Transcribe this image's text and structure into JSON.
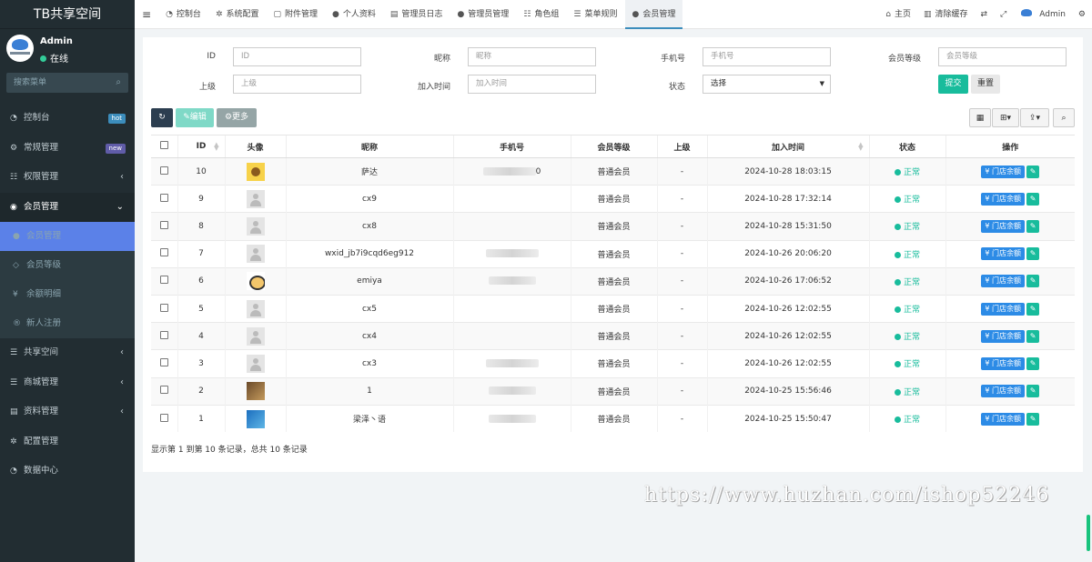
{
  "app": {
    "title": "TB共享空间"
  },
  "user": {
    "name": "Admin",
    "status": "在线"
  },
  "sidebar": {
    "search_placeholder": "搜索菜单",
    "items": [
      {
        "label": "控制台",
        "badge": "hot"
      },
      {
        "label": "常规管理",
        "badge": "new"
      },
      {
        "label": "权限管理",
        "arrow": "‹"
      },
      {
        "label": "会员管理",
        "arrow": "⌄"
      },
      {
        "label": "会员管理"
      },
      {
        "label": "会员等级"
      },
      {
        "label": "余额明细"
      },
      {
        "label": "新人注册"
      },
      {
        "label": "共享空间",
        "arrow": "‹"
      },
      {
        "label": "商城管理",
        "arrow": "‹"
      },
      {
        "label": "资料管理",
        "arrow": "‹"
      },
      {
        "label": "配置管理"
      },
      {
        "label": "数据中心"
      }
    ]
  },
  "topbar": {
    "tabs": [
      {
        "label": "控制台"
      },
      {
        "label": "系统配置"
      },
      {
        "label": "附件管理"
      },
      {
        "label": "个人资料"
      },
      {
        "label": "管理员日志"
      },
      {
        "label": "管理员管理"
      },
      {
        "label": "角色组"
      },
      {
        "label": "菜单规则"
      },
      {
        "label": "会员管理"
      }
    ],
    "right": {
      "home": "主页",
      "clear_cache": "清除缓存",
      "admin": "Admin"
    }
  },
  "filters": {
    "id": {
      "label": "ID",
      "placeholder": "ID"
    },
    "nickname": {
      "label": "昵称",
      "placeholder": "昵称"
    },
    "mobile": {
      "label": "手机号",
      "placeholder": "手机号"
    },
    "level": {
      "label": "会员等级",
      "placeholder": "会员等级"
    },
    "parent": {
      "label": "上级",
      "placeholder": "上级"
    },
    "jointime": {
      "label": "加入时间",
      "placeholder": "加入时间"
    },
    "status": {
      "label": "状态",
      "value": "选择"
    },
    "submit": "提交",
    "reset": "重置"
  },
  "toolbar": {
    "edit": "编辑",
    "more": "更多"
  },
  "table": {
    "headers": [
      "ID",
      "头像",
      "昵称",
      "手机号",
      "会员等级",
      "上级",
      "加入时间",
      "状态",
      "操作"
    ],
    "rows": [
      {
        "id": "10",
        "avatar": "bear",
        "nickname": "萨达",
        "mobile": "0",
        "level": "普通会员",
        "parent": "-",
        "jointime": "2024-10-28 18:03:15",
        "status": "正常",
        "op": "¥ 门店余额"
      },
      {
        "id": "9",
        "avatar": "def",
        "nickname": "cx9",
        "mobile": "",
        "level": "普通会员",
        "parent": "-",
        "jointime": "2024-10-28 17:32:14",
        "status": "正常",
        "op": "¥ 门店余额"
      },
      {
        "id": "8",
        "avatar": "def",
        "nickname": "cx8",
        "mobile": "",
        "level": "普通会员",
        "parent": "-",
        "jointime": "2024-10-28 15:31:50",
        "status": "正常",
        "op": "¥ 门店余额"
      },
      {
        "id": "7",
        "avatar": "def",
        "nickname": "wxid_jb7i9cqd6eg912",
        "mobile": "",
        "level": "普通会员",
        "parent": "-",
        "jointime": "2024-10-26 20:06:20",
        "status": "正常",
        "op": "¥ 门店余额"
      },
      {
        "id": "6",
        "avatar": "panda",
        "nickname": "emiya",
        "mobile": "",
        "level": "普通会员",
        "parent": "-",
        "jointime": "2024-10-26 17:06:52",
        "status": "正常",
        "op": "¥ 门店余额"
      },
      {
        "id": "5",
        "avatar": "def",
        "nickname": "cx5",
        "mobile": "",
        "level": "普通会员",
        "parent": "-",
        "jointime": "2024-10-26 12:02:55",
        "status": "正常",
        "op": "¥ 门店余额"
      },
      {
        "id": "4",
        "avatar": "def",
        "nickname": "cx4",
        "mobile": "",
        "level": "普通会员",
        "parent": "-",
        "jointime": "2024-10-26 12:02:55",
        "status": "正常",
        "op": "¥ 门店余额"
      },
      {
        "id": "3",
        "avatar": "def",
        "nickname": "cx3",
        "mobile": "",
        "level": "普通会员",
        "parent": "-",
        "jointime": "2024-10-26 12:02:55",
        "status": "正常",
        "op": "¥ 门店余额"
      },
      {
        "id": "2",
        "avatar": "photo",
        "nickname": "1",
        "mobile": "",
        "level": "普通会员",
        "parent": "-",
        "jointime": "2024-10-25 15:56:46",
        "status": "正常",
        "op": "¥ 门店余额"
      },
      {
        "id": "1",
        "avatar": "blue",
        "nickname": "梁泽丶语",
        "mobile": "",
        "level": "普通会员",
        "parent": "-",
        "jointime": "2024-10-25 15:50:47",
        "status": "正常",
        "op": "¥ 门店余额"
      }
    ]
  },
  "pagination": {
    "summary": "显示第 1 到第 10 条记录，总共 10 条记录"
  },
  "watermark": "https://www.huzhan.com/ishop52246",
  "colors": {
    "sidebar_bg": "#222d32",
    "active_item": "#5b81e8",
    "status_ok": "#18bc9c",
    "primary": "#2c8be6",
    "submit": "#18bc9c"
  }
}
